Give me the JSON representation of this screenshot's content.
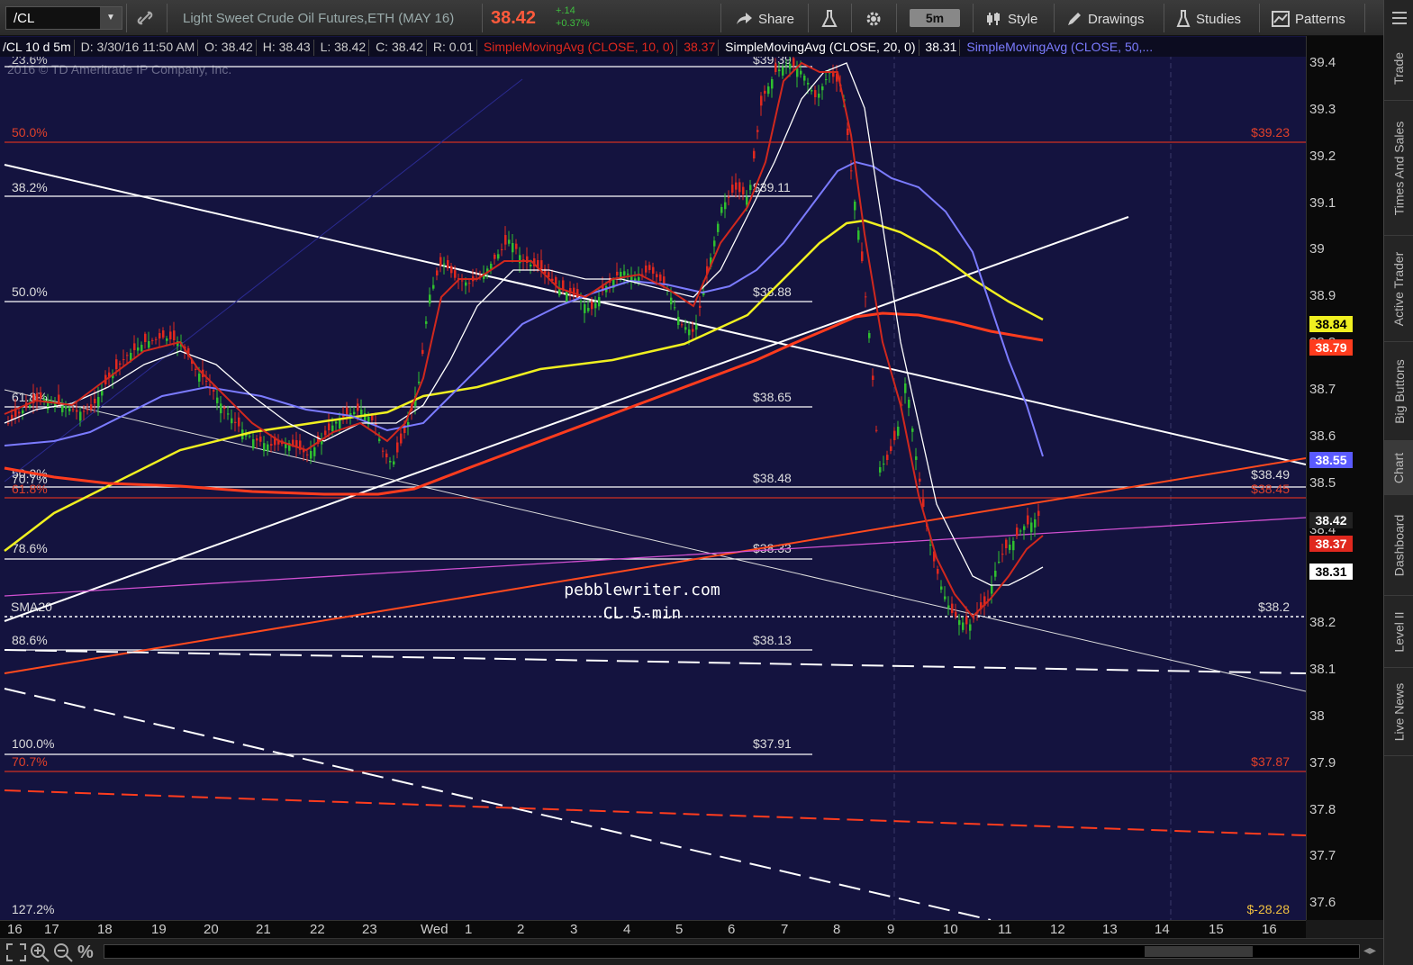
{
  "toolbar": {
    "symbol": "/CL",
    "description": "Light Sweet Crude Oil Futures,ETH (MAY 16)",
    "last_price": "38.42",
    "change": "+.14",
    "change_pct": "+0.37%",
    "share_label": "Share",
    "timeframe": "5m",
    "style_label": "Style",
    "drawings_label": "Drawings",
    "studies_label": "Studies",
    "patterns_label": "Patterns"
  },
  "info_bar": {
    "symbol_period": "/CL 10 d 5m",
    "date": "D: 3/30/16 11:50 AM",
    "open": "O: 38.42",
    "high": "H: 38.43",
    "low": "L: 38.42",
    "close": "C: 38.42",
    "range": "R: 0.01",
    "sma10_label": "SimpleMovingAvg (CLOSE, 10, 0)",
    "sma10_value": "38.37",
    "sma20_label": "SimpleMovingAvg (CLOSE, 20, 0)",
    "sma20_value": "38.31",
    "sma50_label": "SimpleMovingAvg (CLOSE, 50,..."
  },
  "chart": {
    "copyright": "2016 © TD Ameritrade IP Company, Inc.",
    "watermark_site": "pebblewriter.com",
    "watermark_caption": "CL 5-min",
    "sma20_label": "SMA20",
    "colors": {
      "background": "#14133f",
      "sma10": "#d0281e",
      "sma20": "#ffffff",
      "sma50": "#7b7bff",
      "sma100": "#f0f020",
      "sma200": "#ff3c1e",
      "up_candle": "#2fbf2f",
      "down_candle": "#e0281e"
    },
    "fib_labels_left": [
      "23.6%",
      "50.0%",
      "38.2%",
      "50.0%",
      "61.8%",
      "50.0%",
      "70.7%",
      "61.8%",
      "78.6%",
      "88.6%",
      "100.0%",
      "70.7%",
      "127.2%"
    ],
    "level_labels": [
      "$39.39",
      "$39.11",
      "$38.88",
      "$38.65",
      "$38.48",
      "$38.33",
      "$38.13",
      "$37.91"
    ],
    "right_labels": [
      "$39.23",
      "$38.49",
      "$38.45",
      "$38.2",
      "$37.87",
      "$-28.28"
    ]
  },
  "price_axis": {
    "ticks": [
      "39.4",
      "39.3",
      "39.2",
      "39.1",
      "39",
      "38.9",
      "38.8",
      "38.7",
      "38.6",
      "38.5",
      "38.4",
      "38.3",
      "38.2",
      "38.1",
      "38",
      "37.9",
      "37.8",
      "37.7",
      "37.6"
    ],
    "tags": [
      {
        "value": "38.84",
        "bg": "#f0f020",
        "fg": "#000"
      },
      {
        "value": "38.79",
        "bg": "#ff3c1e",
        "fg": "#fff"
      },
      {
        "value": "38.55",
        "bg": "#5a5aff",
        "fg": "#fff"
      },
      {
        "value": "38.42",
        "bg": "#222",
        "fg": "#fff"
      },
      {
        "value": "38.37",
        "bg": "#e0281e",
        "fg": "#fff"
      },
      {
        "value": "38.31",
        "bg": "#ffffff",
        "fg": "#000"
      }
    ]
  },
  "time_axis": {
    "ticks": [
      "16",
      "17",
      "18",
      "19",
      "20",
      "21",
      "22",
      "23",
      "Wed",
      "1",
      "2",
      "3",
      "4",
      "5",
      "6",
      "7",
      "8",
      "9",
      "10",
      "11",
      "12",
      "13",
      "14",
      "15",
      "16"
    ]
  },
  "side_panel": {
    "tabs": [
      "Trade",
      "Times And Sales",
      "Active Trader",
      "Big Buttons",
      "Chart",
      "Dashboard",
      "Level II",
      "Live News"
    ]
  },
  "icons": {
    "link": "link-icon",
    "share": "share-icon",
    "flask": "flask-icon",
    "gear": "gear-icon",
    "style": "style-icon",
    "pencil": "pencil-icon",
    "studies": "studies-icon",
    "patterns": "patterns-icon",
    "menu": "menu-icon",
    "zoom_fit": "zoom-fit-icon",
    "zoom_in": "zoom-in-icon",
    "zoom_out": "zoom-out-icon",
    "percent": "percent-icon"
  }
}
